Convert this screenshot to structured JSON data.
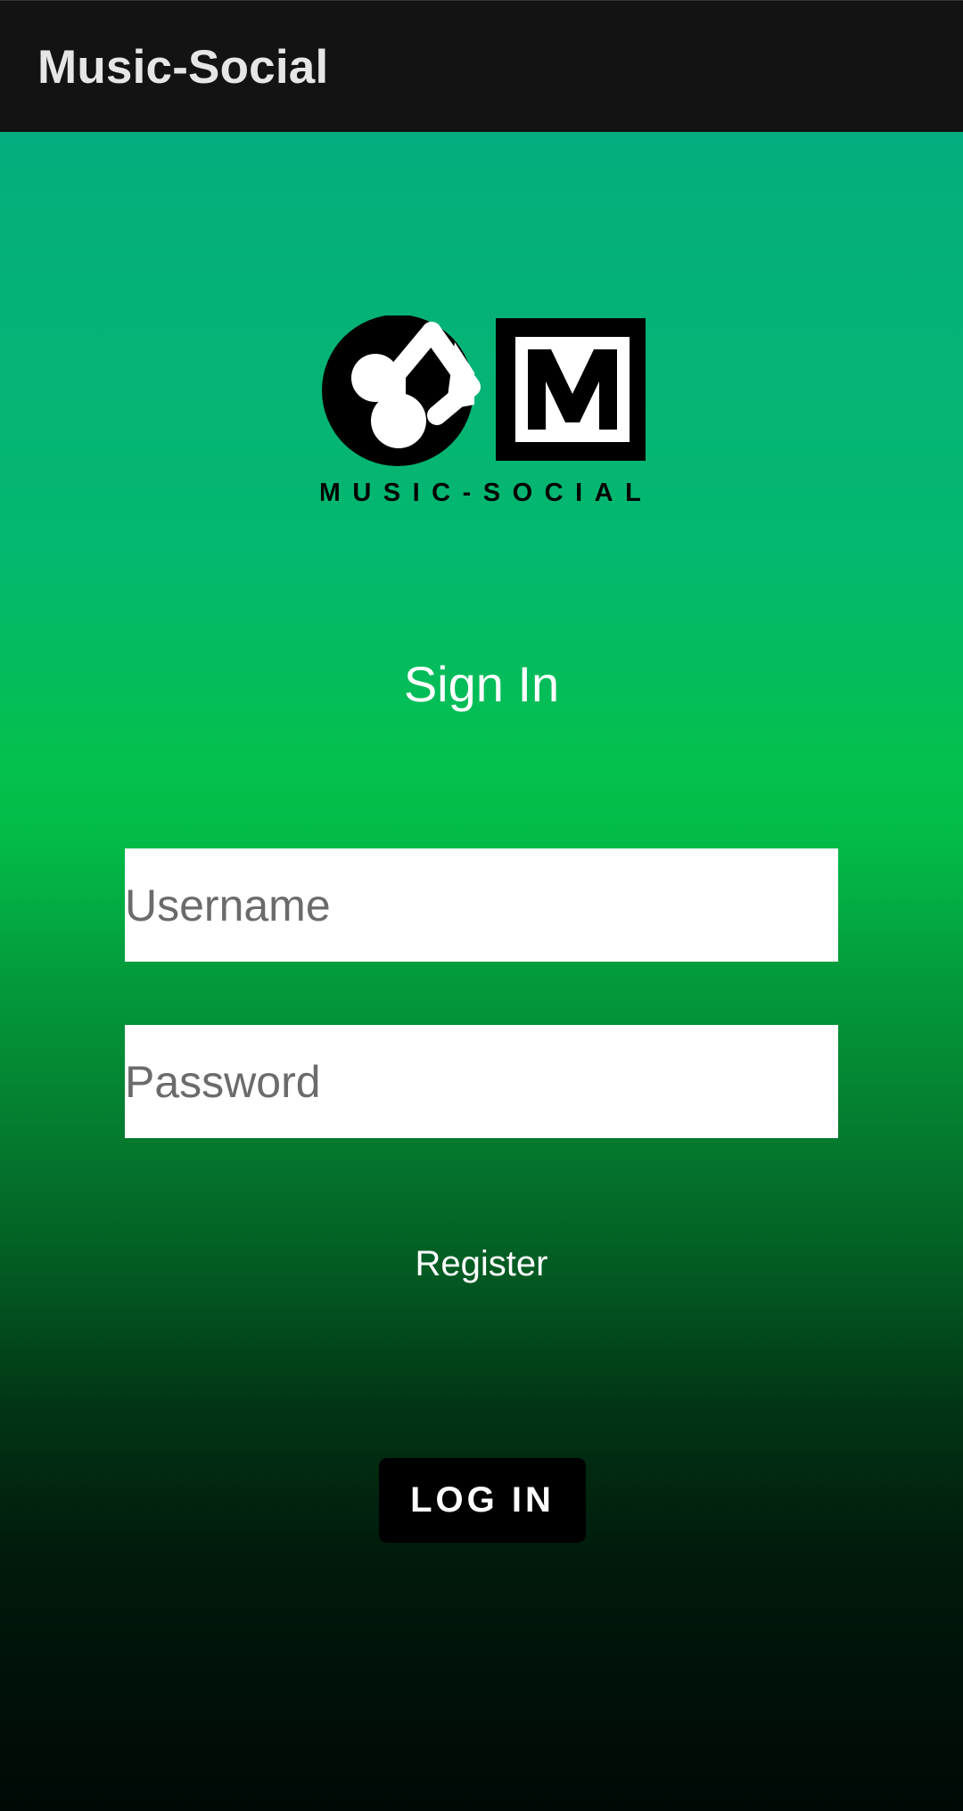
{
  "app_bar": {
    "title": "Music-Social"
  },
  "logo": {
    "wordmark": "MUSIC-SOCIAL",
    "monogram": "M",
    "icon": "music-note-icon"
  },
  "sign_in": {
    "title": "Sign In",
    "username_placeholder": "Username",
    "password_placeholder": "Password",
    "register_label": "Register",
    "login_label": "LOG IN"
  },
  "colors": {
    "app_bar_bg": "#131313",
    "gradient_top": "#05ae7e",
    "gradient_mid": "#04c04c",
    "gradient_bottom": "#000905",
    "button_bg": "#000000"
  }
}
